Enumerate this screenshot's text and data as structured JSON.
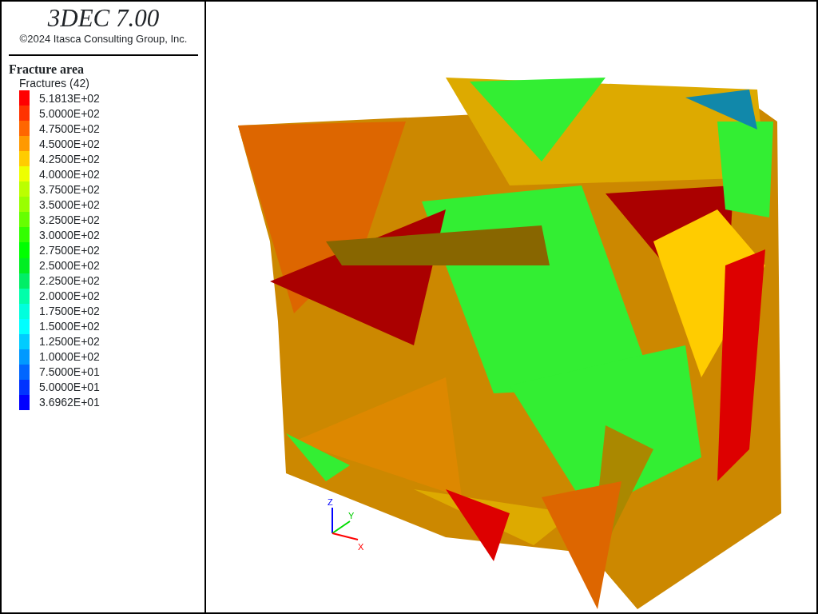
{
  "title": "3DEC 7.00",
  "copyright": "©2024 Itasca Consulting Group, Inc.",
  "legend": {
    "heading": "Fracture area",
    "subheading": "Fractures (42)",
    "entries": [
      {
        "label": "5.1813E+02",
        "color": "#ff0000"
      },
      {
        "label": "5.0000E+02",
        "color": "#ff3300"
      },
      {
        "label": "4.7500E+02",
        "color": "#ff6600"
      },
      {
        "label": "4.5000E+02",
        "color": "#ff9900"
      },
      {
        "label": "4.2500E+02",
        "color": "#ffcc00"
      },
      {
        "label": "4.0000E+02",
        "color": "#eeff00"
      },
      {
        "label": "3.7500E+02",
        "color": "#bbff00"
      },
      {
        "label": "3.5000E+02",
        "color": "#99ff00"
      },
      {
        "label": "3.2500E+02",
        "color": "#66ff00"
      },
      {
        "label": "3.0000E+02",
        "color": "#33ff00"
      },
      {
        "label": "2.7500E+02",
        "color": "#00ff00"
      },
      {
        "label": "2.5000E+02",
        "color": "#00ee22"
      },
      {
        "label": "2.2500E+02",
        "color": "#00ee66"
      },
      {
        "label": "2.0000E+02",
        "color": "#00ffaa"
      },
      {
        "label": "1.7500E+02",
        "color": "#00ffdd"
      },
      {
        "label": "1.5000E+02",
        "color": "#00ffff"
      },
      {
        "label": "1.2500E+02",
        "color": "#00ccff"
      },
      {
        "label": "1.0000E+02",
        "color": "#0099ff"
      },
      {
        "label": "7.5000E+01",
        "color": "#0066ff"
      },
      {
        "label": "5.0000E+01",
        "color": "#0033ff"
      },
      {
        "label": "3.6962E+01",
        "color": "#0000ff"
      }
    ]
  },
  "axes": {
    "x": "X",
    "y": "Y",
    "z": "Z"
  }
}
